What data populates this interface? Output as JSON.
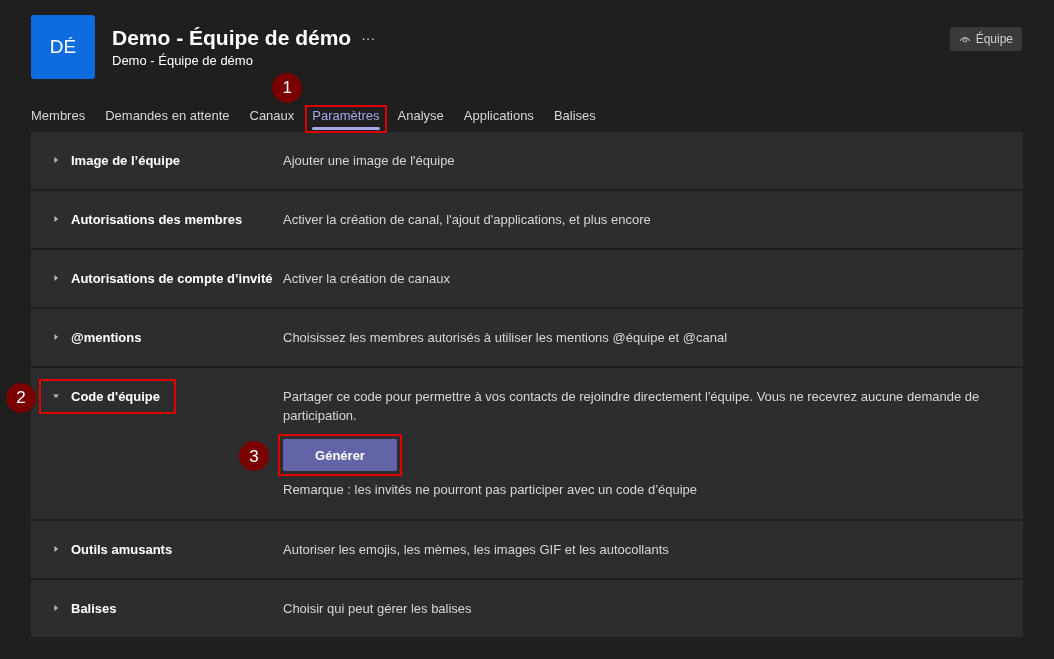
{
  "team": {
    "initials": "DÉ",
    "title": "Demo - Équipe de démo",
    "more": "···",
    "subtitle": "Demo - Équipe de démo",
    "visibility": "Équipe"
  },
  "tabs": [
    {
      "label": "Membres",
      "selected": false
    },
    {
      "label": "Demandes en attente",
      "selected": false
    },
    {
      "label": "Canaux",
      "selected": false
    },
    {
      "label": "Paramètres",
      "selected": true,
      "callout": "1"
    },
    {
      "label": "Analyse",
      "selected": false
    },
    {
      "label": "Applications",
      "selected": false
    },
    {
      "label": "Balises",
      "selected": false
    }
  ],
  "sections": [
    {
      "title": "Image de l’équipe",
      "description": "Ajouter une image de l'équipe",
      "expanded": false
    },
    {
      "title": "Autorisations des membres",
      "description": "Activer la création de canal, l'ajout d'applications, et plus encore",
      "expanded": false
    },
    {
      "title": "Autorisations de compte d’invité",
      "description": "Activer la création de canaux",
      "expanded": false
    },
    {
      "title": "@mentions",
      "description": "Choisissez les membres autorisés à utiliser les mentions @équipe et @canal",
      "expanded": false
    },
    {
      "title": "Code d'équipe",
      "description": "Partager ce code pour permettre à vos contacts de rejoindre directement l'équipe. Vous ne recevrez aucune demande de participation.",
      "expanded": true,
      "callout": "2",
      "button": {
        "label": "Générer",
        "callout": "3"
      },
      "note": "Remarque : les invités ne pourront pas participer avec un code d’équipe"
    },
    {
      "title": "Outils amusants",
      "description": "Autoriser les emojis, les mèmes, les images GIF et les autocollants",
      "expanded": false
    },
    {
      "title": "Balises",
      "description": "Choisir qui peut gérer les balises",
      "expanded": false
    }
  ]
}
